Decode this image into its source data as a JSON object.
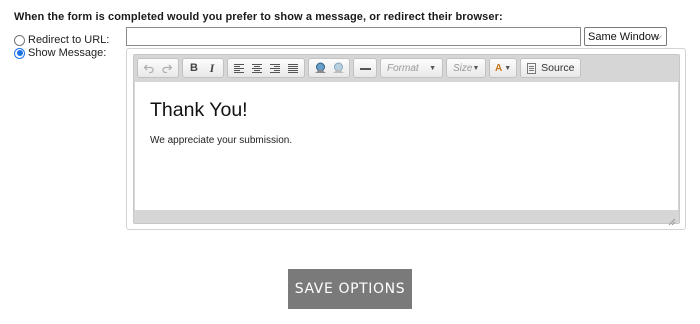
{
  "form": {
    "question": "When the form is completed would you prefer to show a message, or redirect their browser:",
    "options": [
      {
        "label": "Redirect to URL:",
        "checked": false
      },
      {
        "label": "Show Message:",
        "checked": true
      }
    ],
    "url": {
      "value": "",
      "placeholder": ""
    },
    "window_select": {
      "selected": "Same Window"
    }
  },
  "editor": {
    "toolbar": {
      "undo_icon": "undo-icon",
      "redo_icon": "redo-icon",
      "bold_label": "B",
      "italic_label": "I",
      "format_label": "Format",
      "size_label": "Size",
      "text_color_label": "A",
      "source_label": "Source"
    },
    "content": {
      "heading": "Thank You!",
      "body": "We appreciate your submission."
    }
  },
  "actions": {
    "save_label": "SAVE OPTIONS"
  },
  "colors": {
    "accent": "#1a73e8",
    "save_button_bg": "#7a7a7a"
  }
}
